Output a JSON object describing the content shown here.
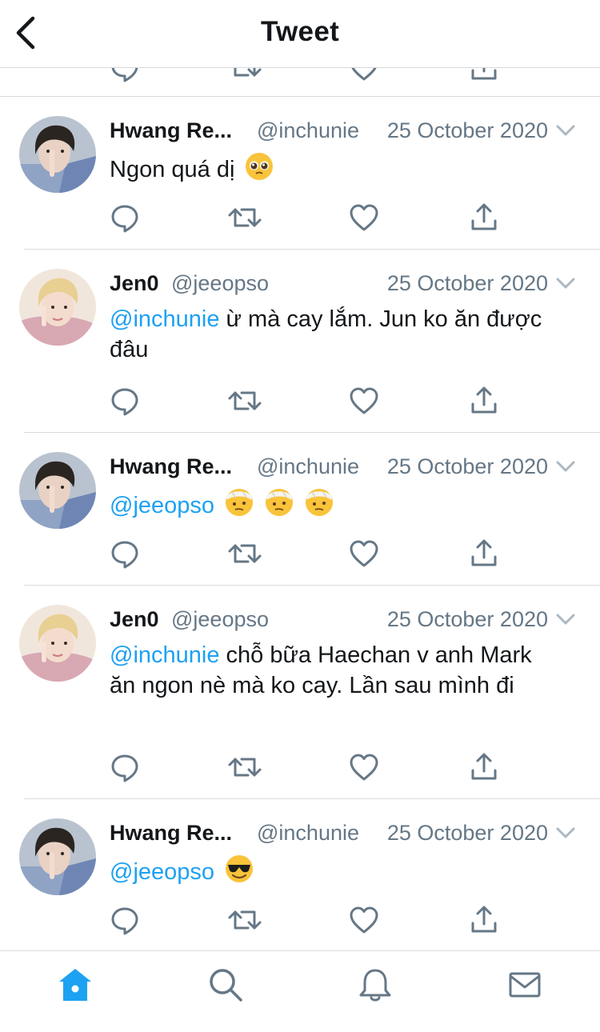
{
  "header": {
    "title": "Tweet",
    "back_icon": "chevron-left-icon"
  },
  "colors": {
    "accent": "#1da1f2",
    "secondary_text": "#657786",
    "icon_gray": "#657786",
    "divider": "#d6dadd"
  },
  "tweets": [
    {
      "author": "Hwang Re...",
      "handle": "@inchunie",
      "date": "25 October 2020",
      "mention": "",
      "text": "Ngon quá dị",
      "emojis": [
        "pleading-face"
      ]
    },
    {
      "author": "Jen0",
      "handle": "@jeeopso",
      "date": "25 October 2020",
      "mention": "@inchunie",
      "text": " ừ mà cay lắm. Jun ko ăn được đâu",
      "emojis": []
    },
    {
      "author": "Hwang Re...",
      "handle": "@inchunie",
      "date": "25 October 2020",
      "mention": "@jeeopso",
      "text": " ",
      "emojis": [
        "face-with-head-bandage",
        "face-with-head-bandage",
        "face-with-head-bandage"
      ]
    },
    {
      "author": "Jen0",
      "handle": "@jeeopso",
      "date": "25 October 2020",
      "mention": "@inchunie",
      "text": " chỗ bữa Haechan v anh Mark  ăn ngon nè mà ko cay. Lần sau mình đi",
      "emojis": []
    },
    {
      "author": "Hwang Re...",
      "handle": "@inchunie",
      "date": "25 October 2020",
      "mention": "@jeeopso",
      "text": " ",
      "emojis": [
        "smiling-face-with-sunglasses"
      ]
    }
  ],
  "action_icons": [
    "reply-icon",
    "retweet-icon",
    "like-icon",
    "share-icon"
  ],
  "tabbar": {
    "items": [
      {
        "icon": "home-icon",
        "active": true
      },
      {
        "icon": "search-icon",
        "active": false
      },
      {
        "icon": "notifications-icon",
        "active": false
      },
      {
        "icon": "messages-icon",
        "active": false
      }
    ]
  }
}
